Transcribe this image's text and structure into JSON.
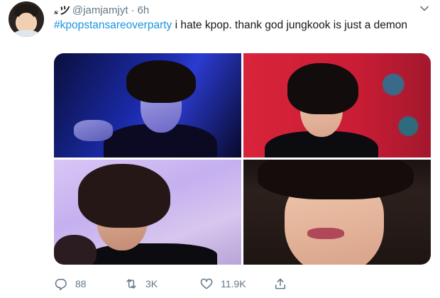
{
  "user": {
    "display_name": "ₛツ",
    "handle": "@jamjamjyt",
    "separator": "·",
    "time": "6h"
  },
  "tweet": {
    "hashtag": "#kpopstansareoverparty",
    "text": " i hate kpop. thank god jungkook is just a demon"
  },
  "actions": {
    "replies": "88",
    "retweets": "3K",
    "likes": "11.9K"
  },
  "icons": {
    "reply": "reply-icon",
    "retweet": "retweet-icon",
    "like": "like-icon",
    "share": "share-icon",
    "menu": "chevron-down-icon"
  },
  "colors": {
    "hashtag": "#1b95e0",
    "secondary_text": "#657786",
    "primary_text": "#14171a"
  }
}
